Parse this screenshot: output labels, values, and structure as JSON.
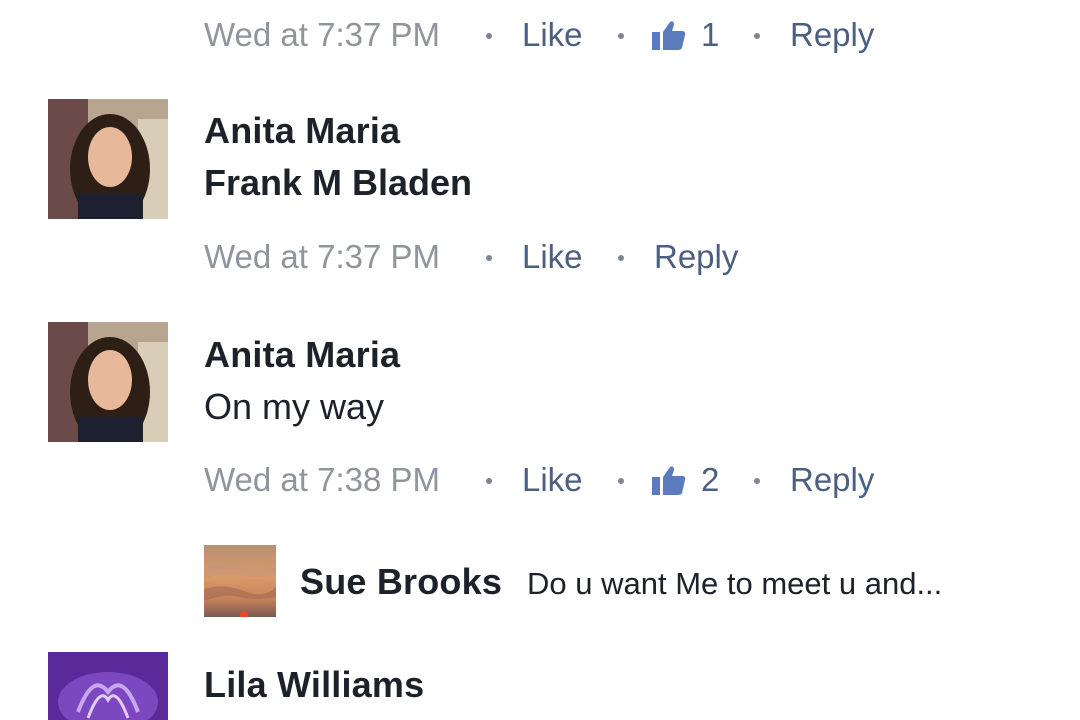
{
  "comments": [
    {
      "timestamp": "Wed at 7:37 PM",
      "like_label": "Like",
      "reaction_icon": "thumbs-up-icon",
      "reaction_count": "1",
      "reply_label": "Reply"
    },
    {
      "author": "Anita Maria",
      "text": "Frank M Bladen",
      "timestamp": "Wed at 7:37 PM",
      "like_label": "Like",
      "reply_label": "Reply"
    },
    {
      "author": "Anita Maria",
      "text": "On my way",
      "timestamp": "Wed at 7:38 PM",
      "like_label": "Like",
      "reaction_icon": "thumbs-up-icon",
      "reaction_count": "2",
      "reply_label": "Reply",
      "reply_preview": {
        "author": "Sue Brooks",
        "text": "Do u want Me to meet u and..."
      }
    },
    {
      "author": "Lila Williams"
    }
  ],
  "colors": {
    "meta": "#90949c",
    "action": "#4b5f82",
    "text": "#1d2129"
  }
}
